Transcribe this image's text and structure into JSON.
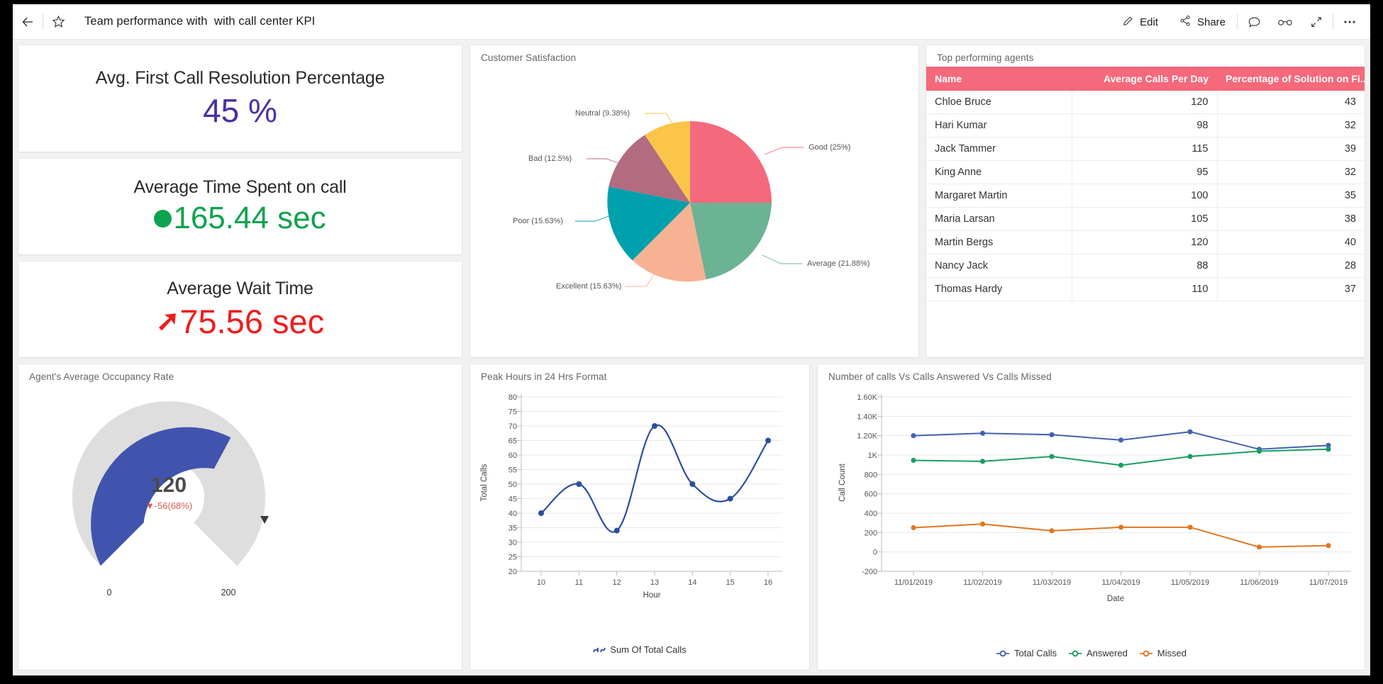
{
  "window": {
    "title": "Team performance with  with call center KPI"
  },
  "toolbar": {
    "back_label": "Back",
    "favorite_label": "Favorite",
    "edit_label": "Edit",
    "share_label": "Share",
    "comment_label": "Comments",
    "view_label": "Reading view",
    "fullscreen_label": "Full screen",
    "more_label": "More options"
  },
  "kpis": [
    {
      "label": "Avg. First Call Resolution Percentage",
      "value": "45 %",
      "color": "#4b2fa5",
      "indicator": "none"
    },
    {
      "label": "Average Time Spent on call",
      "value": "165.44 sec",
      "color": "#0da34e",
      "indicator": "circle"
    },
    {
      "label": "Average Wait Time",
      "value": "75.56 sec",
      "color": "#f01c1c",
      "indicator": "up-arrow"
    }
  ],
  "panels": {
    "satisfaction_title": "Customer Satisfaction",
    "agents_title": "Top performing agents",
    "occupancy_title": "Agent's Average Occupancy Rate",
    "peak_title": "Peak Hours in 24 Hrs Format",
    "calls_title": "Number of calls Vs Calls Answered Vs Calls Missed"
  },
  "agents_table": {
    "columns": [
      "Name",
      "Average Calls Per Day",
      "Percentage of Solution on Fi..."
    ],
    "rows": [
      [
        "Chloe Bruce",
        "120",
        "43"
      ],
      [
        "Hari Kumar",
        "98",
        "32"
      ],
      [
        "Jack Tammer",
        "115",
        "39"
      ],
      [
        "King Anne",
        "95",
        "32"
      ],
      [
        "Margaret Martin",
        "100",
        "35"
      ],
      [
        "Maria Larsan",
        "105",
        "38"
      ],
      [
        "Martin Bergs",
        "120",
        "40"
      ],
      [
        "Nancy Jack",
        "88",
        "28"
      ],
      [
        "Thomas Hardy",
        "110",
        "37"
      ]
    ],
    "header_color": "#f4697b"
  },
  "chart_data": [
    {
      "type": "pie",
      "title": "Customer Satisfaction",
      "categories": [
        "Good",
        "Average",
        "Excellent",
        "Poor",
        "Bad",
        "Neutral"
      ],
      "values": [
        25,
        21.88,
        15.63,
        15.63,
        12.5,
        9.38
      ],
      "labels": [
        "Good (25%)",
        "Average (21.88%)",
        "Excellent (15.63%)",
        "Poor (15.63%)",
        "Bad (12.5%)",
        "Neutral (9.38%)"
      ],
      "colors": [
        "#f4697b",
        "#6cb295",
        "#f7b294",
        "#00a0ad",
        "#b26b7f",
        "#fbc54a"
      ],
      "legend": "labels-outside"
    },
    {
      "type": "gauge",
      "title": "Agent's Average Occupancy Rate",
      "value": 120,
      "delta_label": "-56(68%)",
      "delta_direction": "down",
      "min": 0,
      "max": 200,
      "min_label": "0",
      "max_label": "200",
      "target": 176,
      "fill_color": "#4154ad",
      "track_color": "#dedede"
    },
    {
      "type": "line",
      "title": "Peak Hours in 24 Hrs Format",
      "xlabel": "Hour",
      "ylabel": "Total Calls",
      "categories": [
        "10",
        "11",
        "12",
        "13",
        "14",
        "15",
        "16"
      ],
      "values": [
        40,
        50,
        34,
        70,
        50,
        45,
        65
      ],
      "ylim": [
        20,
        80
      ],
      "yticks": [
        "20",
        "25",
        "30",
        "35",
        "40",
        "45",
        "50",
        "55",
        "60",
        "65",
        "70",
        "75",
        "80"
      ],
      "grid": true,
      "smooth": true,
      "color": "#2b4f9e",
      "legend": [
        "Sum Of Total Calls"
      ],
      "legend_position": "bottom"
    },
    {
      "type": "line",
      "title": "Number of calls Vs Calls Answered Vs Calls Missed",
      "xlabel": "Date",
      "ylabel": "Call Count",
      "categories": [
        "11/01/2019",
        "11/02/2019",
        "11/03/2019",
        "11/04/2019",
        "11/05/2019",
        "11/06/2019",
        "11/07/2019"
      ],
      "series": [
        {
          "name": "Total Calls",
          "values": [
            1200,
            1225,
            1210,
            1155,
            1240,
            1060,
            1100
          ],
          "color": "#4262b0"
        },
        {
          "name": "Answered",
          "values": [
            945,
            935,
            985,
            895,
            985,
            1040,
            1060
          ],
          "color": "#1a9e62"
        },
        {
          "name": "Missed",
          "values": [
            250,
            288,
            218,
            255,
            255,
            50,
            65
          ],
          "color": "#e2761f"
        }
      ],
      "ylim": [
        -200,
        1600
      ],
      "yticks": [
        "1.60K",
        "1.40K",
        "1.20K",
        "1K",
        "800",
        "600",
        "400",
        "200",
        "0",
        "-200"
      ],
      "grid": true,
      "legend_position": "bottom"
    }
  ]
}
